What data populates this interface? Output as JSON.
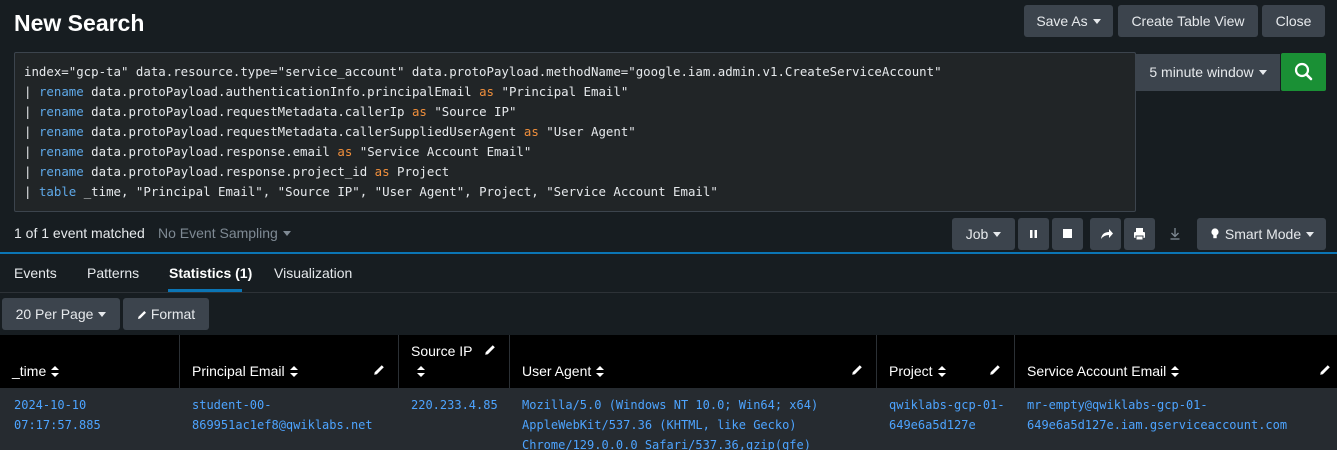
{
  "header": {
    "title": "New Search",
    "save_as": "Save As",
    "create_table_view": "Create Table View",
    "close": "Close"
  },
  "search": {
    "line1": "index=\"gcp-ta\" data.resource.type=\"service_account\" data.protoPayload.methodName=\"google.iam.admin.v1.CreateServiceAccount\"",
    "lines": [
      {
        "cmd": "rename",
        "field": "data.protoPayload.authenticationInfo.principalEmail",
        "as": "as",
        "alias": "\"Principal Email\""
      },
      {
        "cmd": "rename",
        "field": "data.protoPayload.requestMetadata.callerIp",
        "as": "as",
        "alias": "\"Source IP\""
      },
      {
        "cmd": "rename",
        "field": "data.protoPayload.requestMetadata.callerSuppliedUserAgent",
        "as": "as",
        "alias": "\"User Agent\""
      },
      {
        "cmd": "rename",
        "field": "data.protoPayload.response.email",
        "as": "as",
        "alias": "\"Service Account Email\""
      },
      {
        "cmd": "rename",
        "field": "data.protoPayload.response.project_id",
        "as": "as",
        "alias": "Project"
      }
    ],
    "table_cmd": "table",
    "table_args": "_time, \"Principal Email\", \"Source IP\", \"User Agent\", Project, \"Service Account Email\"",
    "pipe": "|",
    "time_window": "5 minute window"
  },
  "status": {
    "matched": "1 of 1 event matched",
    "sampling": "No Event Sampling",
    "job": "Job",
    "smart_mode": "Smart Mode"
  },
  "tabs": [
    {
      "label": "Events"
    },
    {
      "label": "Patterns"
    },
    {
      "label": "Statistics (1)"
    },
    {
      "label": "Visualization"
    }
  ],
  "controls": {
    "per_page": "20 Per Page",
    "format": "Format"
  },
  "table": {
    "columns": [
      "_time",
      "Principal Email",
      "Source IP",
      "User Agent",
      "Project",
      "Service Account Email"
    ],
    "row": {
      "time": [
        "2024-10-10",
        "07:17:57.885"
      ],
      "principal_email": [
        "student-00-",
        "869951ac1ef8@qwiklabs.net"
      ],
      "source_ip": [
        "220.233.4.85"
      ],
      "user_agent": [
        "Mozilla/5.0 (Windows NT 10.0; Win64; x64)",
        "AppleWebKit/537.36 (KHTML, like Gecko)",
        "Chrome/129.0.0.0 Safari/537.36,gzip(gfe)"
      ],
      "project": [
        "qwiklabs-gcp-01-",
        "649e6a5d127e"
      ],
      "service_account_email": [
        "mr-empty@qwiklabs-gcp-01-",
        "649e6a5d127e.iam.gserviceaccount.com"
      ]
    }
  },
  "colors": {
    "accent": "#0b75b5",
    "search_button": "#1a9035",
    "link": "#4da4ff",
    "keyword_command": "#5fa9e8",
    "keyword_as": "#f08f3c"
  }
}
